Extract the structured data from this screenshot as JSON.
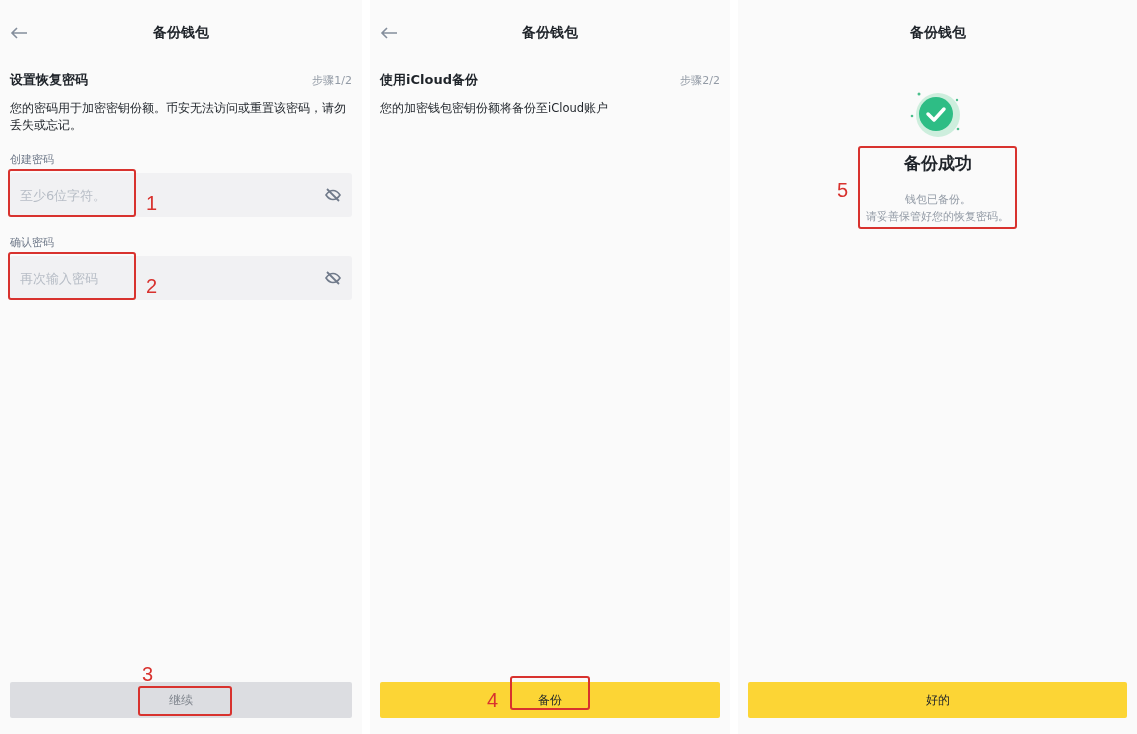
{
  "screens": [
    {
      "header": {
        "title": "备份钱包",
        "back": true
      },
      "section": {
        "title": "设置恢复密码",
        "step": "步骤1/2"
      },
      "description": "您的密码用于加密密钥份额。币安无法访问或重置该密码，请勿丢失或忘记。",
      "fields": [
        {
          "label": "创建密码",
          "placeholder": "至少6位字符。",
          "annotation": {
            "number": "1"
          }
        },
        {
          "label": "确认密码",
          "placeholder": "再次输入密码",
          "annotation": {
            "number": "2"
          }
        }
      ],
      "button": {
        "label": "继续",
        "disabled": true,
        "annotation": {
          "number": "3"
        }
      }
    },
    {
      "header": {
        "title": "备份钱包",
        "back": true
      },
      "section": {
        "title": "使用iCloud备份",
        "step": "步骤2/2"
      },
      "description": "您的加密钱包密钥份额将备份至iCloud账户",
      "button": {
        "label": "备份",
        "disabled": false,
        "annotation": {
          "number": "4"
        }
      }
    },
    {
      "header": {
        "title": "备份钱包",
        "back": false
      },
      "result": {
        "title": "备份成功",
        "lines": [
          "钱包已备份。",
          "请妥善保管好您的恢复密码。"
        ],
        "annotation": {
          "number": "5"
        }
      },
      "button": {
        "label": "好的",
        "disabled": false
      }
    }
  ]
}
